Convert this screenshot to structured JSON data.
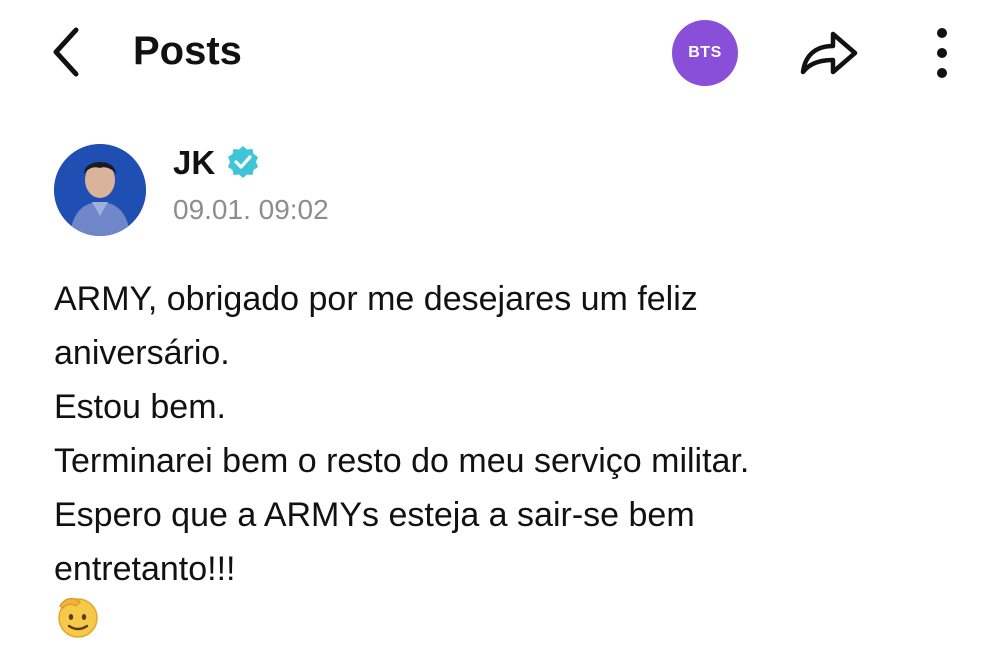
{
  "header": {
    "title": "Posts",
    "community_badge": "BTS",
    "back_icon": "chevron-left-icon",
    "share_icon": "share-arrow-icon",
    "more_icon": "more-vertical-icon"
  },
  "author": {
    "name": "JK",
    "verified": true,
    "timestamp": "09.01. 09:02"
  },
  "post": {
    "lines": [
      "ARMY, obrigado por me desejares um feliz",
      "aniversário.",
      "Estou bem.",
      "Terminarei bem o resto do meu serviço militar.",
      "Espero que a ARMYs esteja a sair-se bem",
      "entretanto!!!"
    ],
    "emoji_icon": "saluting-face-emoji"
  },
  "colors": {
    "badge": "#8a4fd8",
    "verified": "#3ec5d6",
    "timestamp": "#8d8d8d"
  }
}
